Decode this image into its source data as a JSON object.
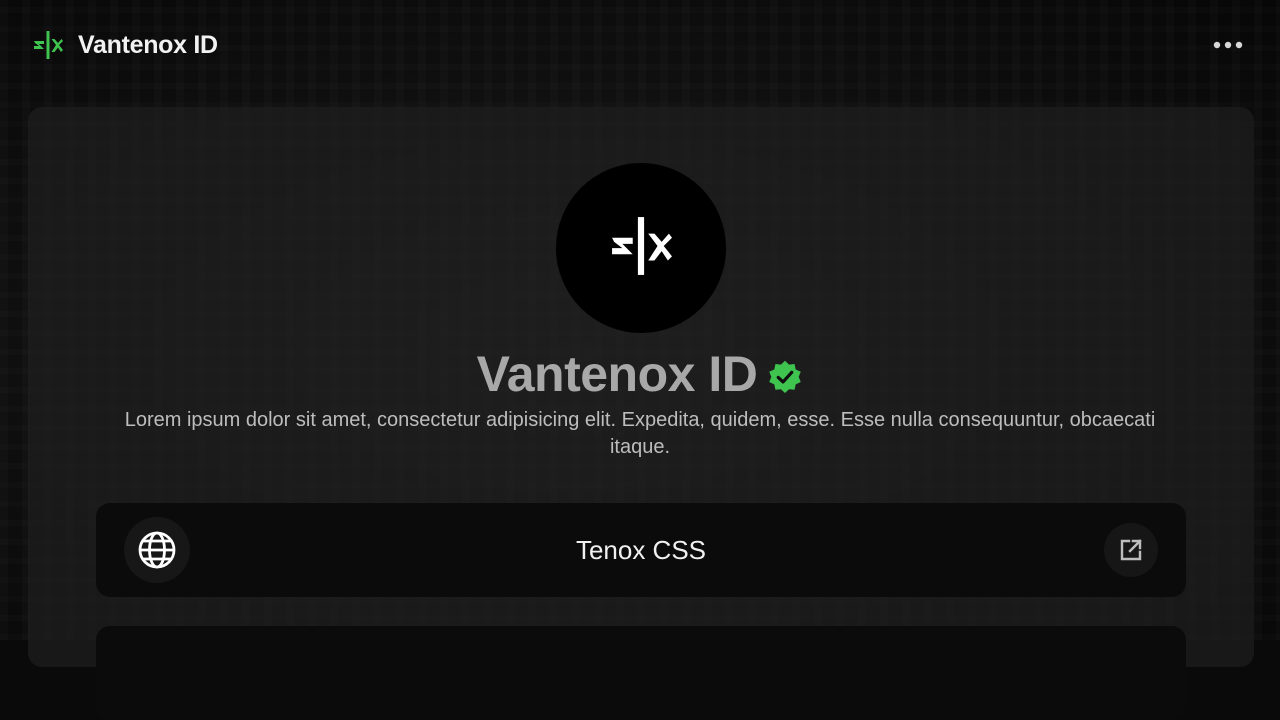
{
  "header": {
    "brand_name": "Vantenox ID",
    "brand_icon": "vantenox-logo-icon",
    "menu_icon": "more-horizontal-icon"
  },
  "profile": {
    "avatar_icon": "vantenox-logo-icon",
    "name": "Vantenox ID",
    "verified_icon": "verified-badge-icon",
    "bio": "Lorem ipsum dolor sit amet, consectetur adipisicing elit. Expedita, quidem, esse. Esse nulla consequuntur, obcaecati itaque."
  },
  "links": [
    {
      "label": "Tenox CSS",
      "icon": "globe-icon",
      "action_icon": "external-link-icon"
    }
  ],
  "colors": {
    "accent_green": "#3ec44f",
    "background": "#0a0a0a",
    "card": "#1e1e1e"
  }
}
